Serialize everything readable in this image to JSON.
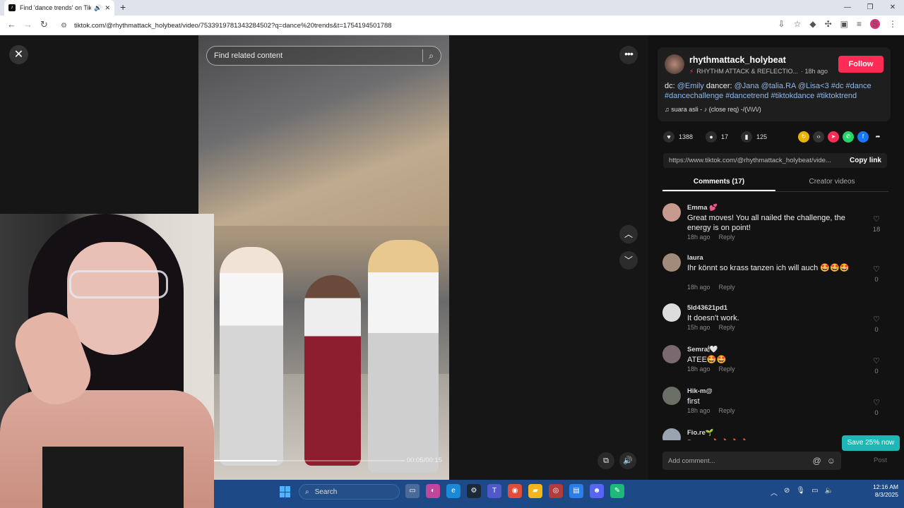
{
  "browser": {
    "tab_title": "Find 'dance trends' on TikT",
    "tab_icon": "tiktok-icon",
    "url": "tiktok.com/@rhythmattack_holybeat/video/7533919781343284502?q=dance%20trends&t=1754194501788",
    "profile_initial": "S"
  },
  "video": {
    "search_placeholder": "Find related content",
    "time": "00:05/00:15",
    "progress": 0.33
  },
  "post": {
    "username": "rhythmattack_holybeat",
    "subtitle": "RHYTHM ATTACK & REFLECTIO...",
    "posted": "· 18h ago",
    "follow_label": "Follow",
    "desc_prefix": "dc: ",
    "desc_tags": "@Emily",
    "desc_mid": " dancer: ",
    "desc_tags2": "@Jana @talia.RA @Lisa<3 #dc #dance #dancechallenge #dancetrend #tiktokdance #tiktoktrend",
    "music": "♫  suara asli - ♪ (close req) -/(\\/\\\\/\\/)",
    "likes": "1388",
    "comments_count": "17",
    "saves": "125",
    "share_link": "https://www.tiktok.com/@rhythmattack_holybeat/vide...",
    "copy_label": "Copy link"
  },
  "tabs": {
    "comments": "Comments (17)",
    "creator": "Creator videos"
  },
  "comments": [
    {
      "name": "Emma 💕",
      "text": "Great moves! You all nailed the challenge, the energy is on point!",
      "time": "18h ago",
      "reply": "Reply",
      "likes": "18",
      "color": "#c79a8f"
    },
    {
      "name": "laura",
      "text": "Ihr könnt so krass tanzen ich will auch 🤩🤩🤩",
      "time": "18h ago",
      "reply": "Reply",
      "likes": "0",
      "color": "#a38b7b"
    },
    {
      "name": "5ld43621pd1",
      "text": "It doesn't work.",
      "time": "15h ago",
      "reply": "Reply",
      "likes": "0",
      "color": "#dddddd"
    },
    {
      "name": "Semra🕯🤍",
      "text": "ATEE🤩🤩",
      "time": "18h ago",
      "reply": "Reply",
      "likes": "0",
      "color": "#7a6a70"
    },
    {
      "name": "Hik-m@",
      "text": "first",
      "time": "18h ago",
      "reply": "Reply",
      "likes": "0",
      "color": "#6a7066"
    },
    {
      "name": "Fio.re🌱",
      "text": "Damn 🔥🔥🔥🔥",
      "time": "",
      "reply": "",
      "likes": "",
      "color": "#9aa3b0"
    }
  ],
  "add_comment_placeholder": "Add comment...",
  "post_label": "Post",
  "promo": "Save 25% now",
  "taskbar": {
    "search_label": "Search",
    "time": "12:16 AM",
    "date": "8/3/2025"
  }
}
